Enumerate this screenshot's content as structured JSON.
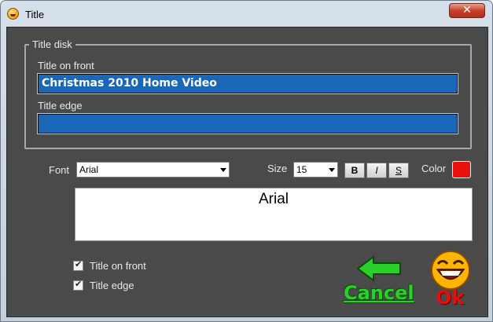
{
  "window": {
    "title": "Title",
    "close_glyph": "✕"
  },
  "group": {
    "legend": "Title disk",
    "front_label": "Title on front",
    "front_value": "Christmas 2010 Home Video",
    "edge_label": "Title edge",
    "edge_value": ""
  },
  "font": {
    "label": "Font",
    "selected": "Arial"
  },
  "size": {
    "label": "Size",
    "selected": "15"
  },
  "style_buttons": {
    "bold": "B",
    "italic": "I",
    "strike": "S"
  },
  "color": {
    "label": "Color",
    "value": "#e8120e"
  },
  "preview": {
    "text": "Arial"
  },
  "checkboxes": [
    {
      "label": "Title on front",
      "checked": true
    },
    {
      "label": "Title edge",
      "checked": true
    }
  ],
  "actions": {
    "cancel": "Cancel",
    "ok": "Ok"
  },
  "icons": {
    "app": "smiley-icon",
    "cancel": "green-left-arrow-icon",
    "ok": "laughing-smiley-icon"
  }
}
